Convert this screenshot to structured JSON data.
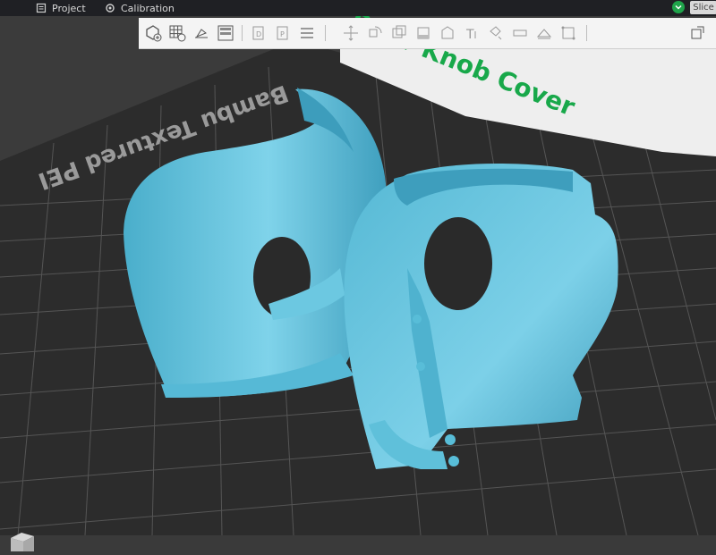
{
  "topbar": {
    "tabs": [
      {
        "label": "Project",
        "icon": "project-icon"
      },
      {
        "label": "Calibration",
        "icon": "calibration-icon"
      }
    ],
    "slice_label": "Slice",
    "status_color": "#1fa34a"
  },
  "toolbar": {
    "tools": [
      "add-object-icon",
      "arrange-grid-icon",
      "auto-orient-icon",
      "layout-icon",
      "copy-icon",
      "paste-icon",
      "list-icon",
      "move-icon",
      "rotate-icon",
      "scale-icon",
      "place-on-face-icon",
      "cut-icon",
      "text-icon",
      "paint-icon",
      "seam-icon",
      "emboss-icon",
      "measure-icon",
      "assembly-icon"
    ]
  },
  "bed": {
    "label_text": "Bambu Textured PEI",
    "model_label": "Door Knob Cover",
    "grid_color": "#5a5a5a",
    "bed_color": "#2e2e2e",
    "model_color": "#62c3dc",
    "accent_color": "#18a84a"
  }
}
